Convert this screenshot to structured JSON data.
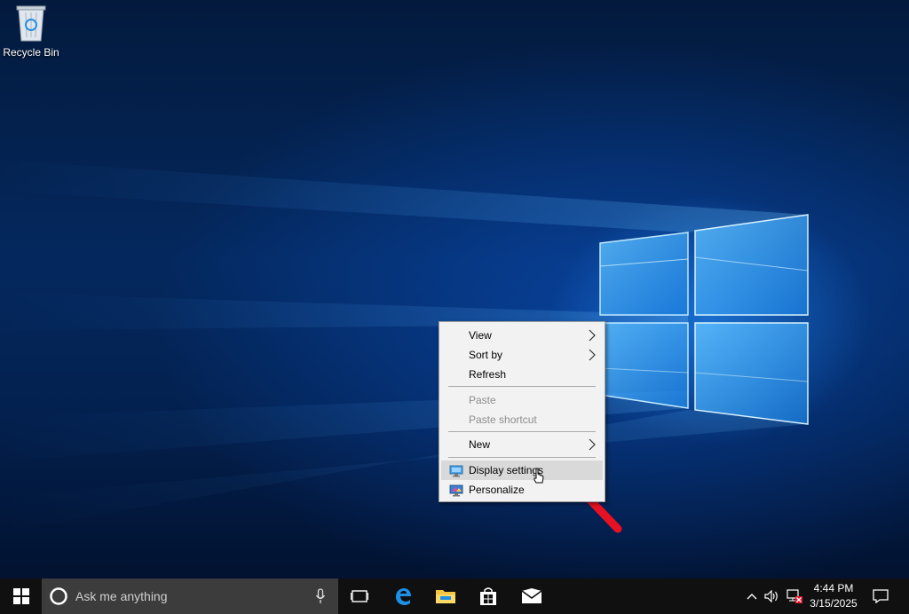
{
  "desktop": {
    "recycle_bin_label": "Recycle Bin"
  },
  "context_menu": {
    "items": [
      {
        "label": "View",
        "submenu": true,
        "enabled": true
      },
      {
        "label": "Sort by",
        "submenu": true,
        "enabled": true
      },
      {
        "label": "Refresh",
        "submenu": false,
        "enabled": true
      },
      {
        "label": "Paste",
        "submenu": false,
        "enabled": false
      },
      {
        "label": "Paste shortcut",
        "submenu": false,
        "enabled": false
      },
      {
        "label": "New",
        "submenu": true,
        "enabled": true
      },
      {
        "label": "Display settings",
        "submenu": false,
        "enabled": true,
        "icon": "display-icon",
        "highlighted": true
      },
      {
        "label": "Personalize",
        "submenu": false,
        "enabled": true,
        "icon": "personalize-icon"
      }
    ]
  },
  "taskbar": {
    "search_placeholder": "Ask me anything",
    "pinned": [
      "task-view-icon",
      "edge-icon",
      "file-explorer-icon",
      "store-icon",
      "mail-icon"
    ],
    "clock": {
      "time": "4:44 PM",
      "date": "3/15/2025"
    },
    "tray": [
      "chevron-up-icon",
      "volume-icon",
      "network-disconnected-icon",
      "action-center-icon"
    ]
  },
  "colors": {
    "accent": "#0078d7",
    "taskbar": "#101010",
    "annotation_arrow": "#e81123"
  }
}
